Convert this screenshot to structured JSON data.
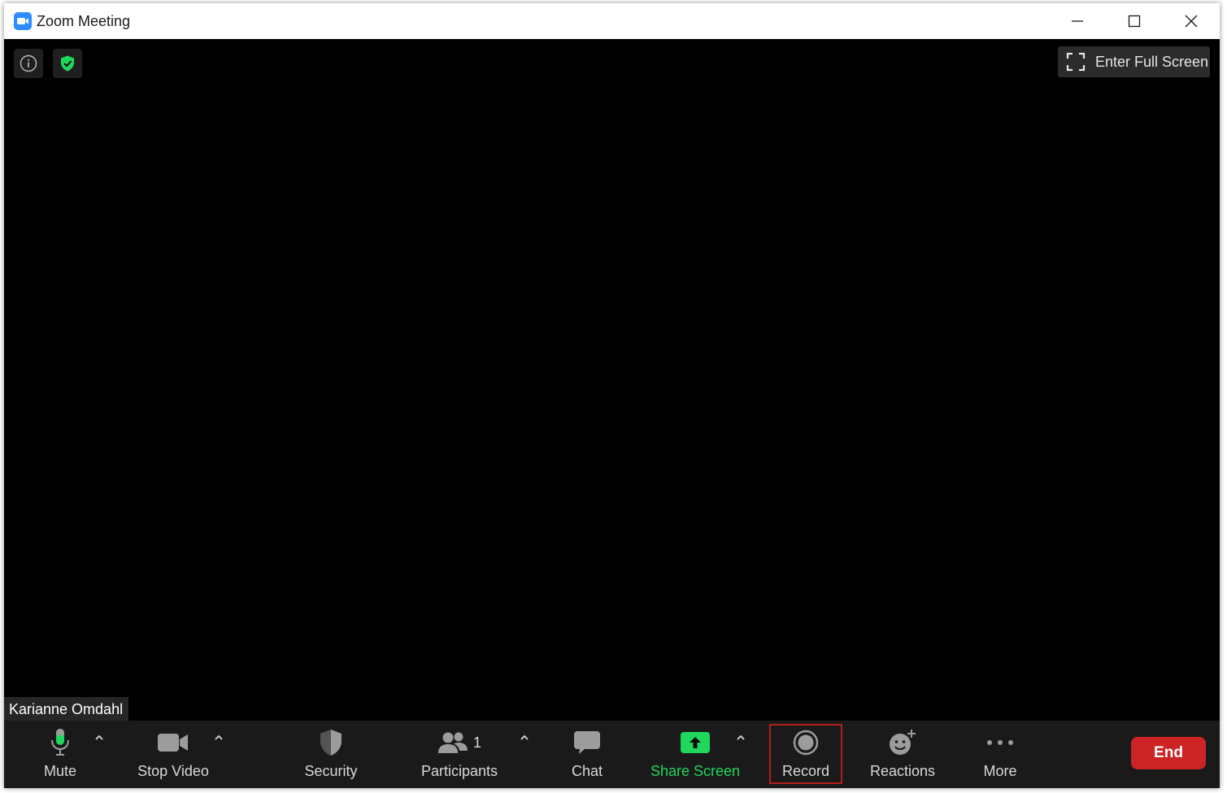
{
  "window": {
    "title": "Zoom Meeting"
  },
  "video": {
    "fullscreen_label": "Enter Full Screen",
    "participant_name": "Karianne Omdahl"
  },
  "toolbar": {
    "mute_label": "Mute",
    "stop_video_label": "Stop Video",
    "security_label": "Security",
    "participants_label": "Participants",
    "participants_count": "1",
    "chat_label": "Chat",
    "share_screen_label": "Share Screen",
    "record_label": "Record",
    "reactions_label": "Reactions",
    "more_label": "More",
    "end_label": "End"
  },
  "colors": {
    "zoom_blue": "#2d8cff",
    "accent_green": "#1fd75c",
    "end_red": "#cc2424",
    "highlight_red": "#b51c1c",
    "toolbar_bg": "#1a1a1a"
  },
  "icons": [
    "zoom-logo-icon",
    "minimize-icon",
    "maximize-icon",
    "close-icon",
    "info-icon",
    "encryption-shield-icon",
    "fullscreen-icon",
    "microphone-icon",
    "video-camera-icon",
    "security-shield-icon",
    "participants-icon",
    "chat-bubble-icon",
    "share-screen-icon",
    "record-icon",
    "reactions-icon",
    "more-dots-icon",
    "chevron-up-icon"
  ]
}
